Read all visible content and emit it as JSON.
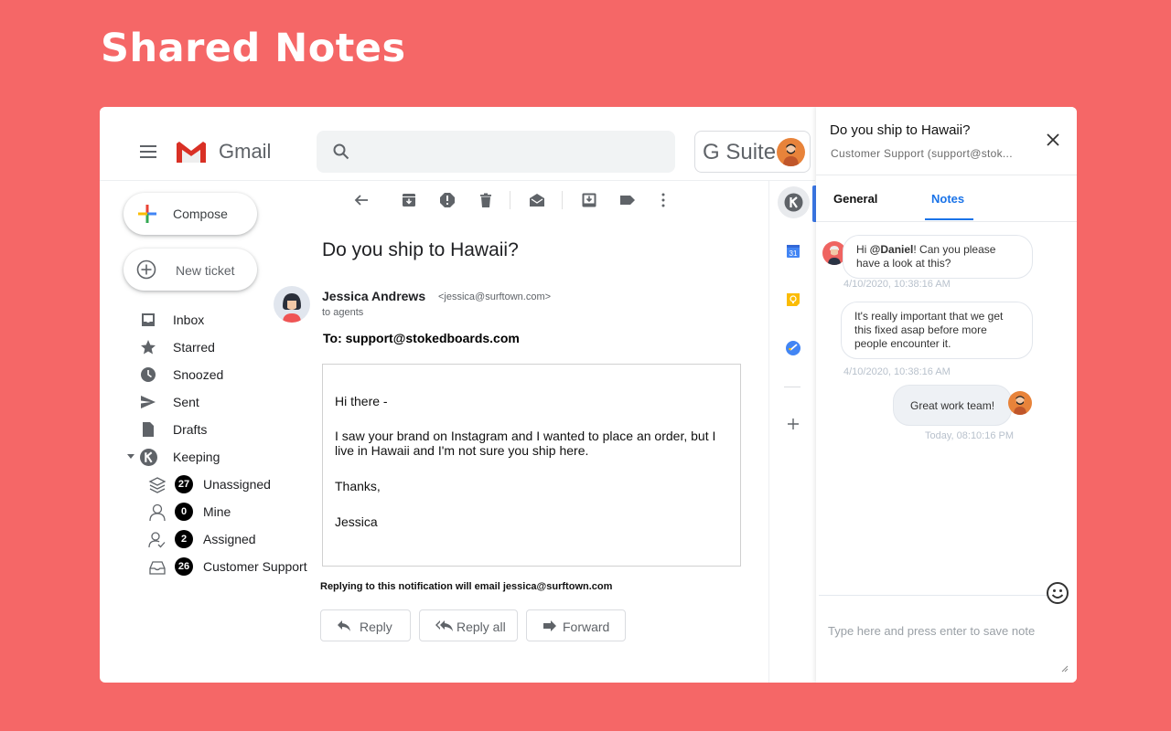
{
  "hero": {
    "title": "Shared Notes"
  },
  "gmail": {
    "app_name": "Gmail",
    "gsuite_label": "G Suite",
    "search_placeholder": ""
  },
  "sidebar": {
    "compose_label": "Compose",
    "new_ticket_label": "New ticket",
    "items": [
      {
        "label": "Inbox",
        "icon": "inbox-icon"
      },
      {
        "label": "Starred",
        "icon": "star-icon"
      },
      {
        "label": "Snoozed",
        "icon": "clock-icon"
      },
      {
        "label": "Sent",
        "icon": "send-icon"
      },
      {
        "label": "Drafts",
        "icon": "draft-icon"
      },
      {
        "label": "Keeping",
        "icon": "keeping-logo-icon"
      }
    ],
    "keeping_items": [
      {
        "label": "Unassigned",
        "count": "27",
        "icon": "layers-icon"
      },
      {
        "label": "Mine",
        "count": "0",
        "icon": "person-icon"
      },
      {
        "label": "Assigned",
        "count": "2",
        "icon": "person-check-icon"
      },
      {
        "label": "Customer Support",
        "count": "26",
        "icon": "tray-icon"
      }
    ]
  },
  "email": {
    "subject": "Do you ship to Hawaii?",
    "sender_name": "Jessica Andrews",
    "sender_email": "<jessica@surftown.com>",
    "recipient_line": "to agents",
    "to_line": "To: support@stokedboards.com",
    "body": {
      "greeting": "Hi there -",
      "paragraph": "I saw your brand on Instagram and I wanted to place an order, but I live in Hawaii and I'm not sure you ship here.",
      "signoff": "Thanks,",
      "signature": "Jessica"
    },
    "reply_note": "Replying to this notification will email jessica@surftown.com",
    "actions": {
      "reply": "Reply",
      "reply_all": "Reply all",
      "forward": "Forward"
    }
  },
  "panel": {
    "title": "Do you ship to Hawaii?",
    "subtitle": "Customer Support (support@stok...",
    "tabs": [
      {
        "label": "General",
        "active": false
      },
      {
        "label": "Notes",
        "active": true
      }
    ],
    "notes": [
      {
        "prefix": "Hi ",
        "mention": "@Daniel",
        "suffix": "! Can you please have a look at this?",
        "timestamp": "4/10/2020, 10:38:16 AM",
        "author": "other"
      },
      {
        "text": "It's really important that we get this fixed asap before more people encounter it.",
        "timestamp": "4/10/2020, 10:38:16 AM",
        "author": "other"
      },
      {
        "text": "Great work team!",
        "timestamp": "Today, 08:10:16 PM",
        "author": "me"
      }
    ],
    "input_placeholder": "Type here and press enter to save note"
  },
  "colors": {
    "background": "#f56767",
    "accent_blue": "#1a73e8",
    "badge": "#000000"
  }
}
